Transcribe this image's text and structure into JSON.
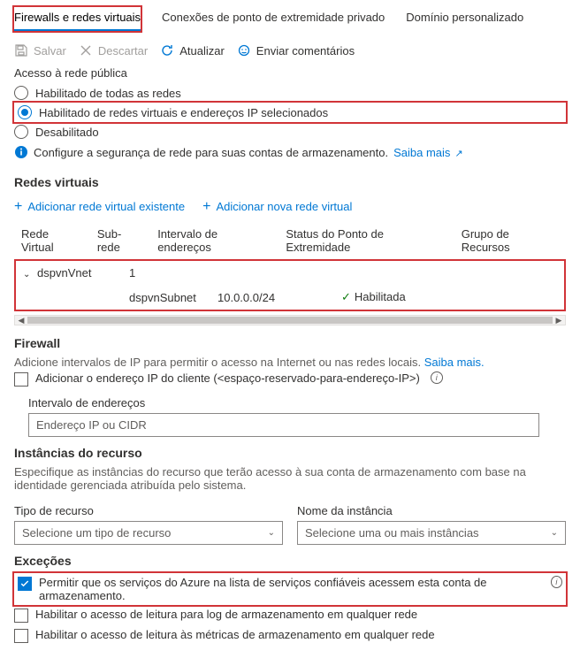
{
  "tabs": {
    "firewalls": "Firewalls e redes virtuais",
    "private": "Conexões de ponto de extremidade privado",
    "custom": "Domínio personalizado"
  },
  "toolbar": {
    "save": "Salvar",
    "discard": "Descartar",
    "refresh": "Atualizar",
    "feedback": "Enviar comentários"
  },
  "public_access": {
    "title": "Acesso à rede pública",
    "opt_all": "Habilitado de todas as redes",
    "opt_selected": "Habilitado de redes virtuais e endereços IP selecionados",
    "opt_disabled": "Desabilitado",
    "info": "Configure a segurança de rede para suas contas de armazenamento.",
    "learn_more": "Saiba mais"
  },
  "vnets": {
    "title": "Redes virtuais",
    "add_existing": "Adicionar rede virtual existente",
    "add_new": "Adicionar nova rede virtual",
    "col_vnet": "Rede Virtual",
    "col_subnet": "Sub-rede",
    "col_range": "Intervalo de endereços",
    "col_status": "Status do Ponto de Extremidade",
    "col_rg": "Grupo de Recursos",
    "row_vnet_name": "dspvnVnet",
    "row_vnet_count": "1",
    "row_subnet_name": "dspvnSubnet",
    "row_subnet_range": "10.0.0.0/24",
    "row_subnet_status": "Habilitada"
  },
  "firewall": {
    "title": "Firewall",
    "desc": "Adicione intervalos de IP para permitir o acesso na Internet ou nas redes locais.",
    "learn_more": "Saiba mais.",
    "add_client": "Adicionar o endereço IP do cliente (<espaço-reservado-para-endereço-IP>)",
    "range_label": "Intervalo de endereços",
    "range_placeholder": "Endereço IP ou CIDR"
  },
  "resource_instances": {
    "title": "Instâncias do recurso",
    "desc": "Especifique as instâncias do recurso que terão acesso à sua conta de armazenamento com base na identidade gerenciada atribuída pelo sistema.",
    "type_label": "Tipo de recurso",
    "name_label": "Nome da instância",
    "type_placeholder": "Selecione um tipo de recurso",
    "name_placeholder": "Selecione uma ou mais instâncias"
  },
  "exceptions": {
    "title": "Exceções",
    "trust": "Permitir que os serviços do Azure na lista de serviços confiáveis acessem esta conta de armazenamento.",
    "log": "Habilitar o acesso de leitura para log de armazenamento em qualquer rede",
    "metrics": "Habilitar o acesso de leitura às métricas de armazenamento em qualquer rede"
  }
}
